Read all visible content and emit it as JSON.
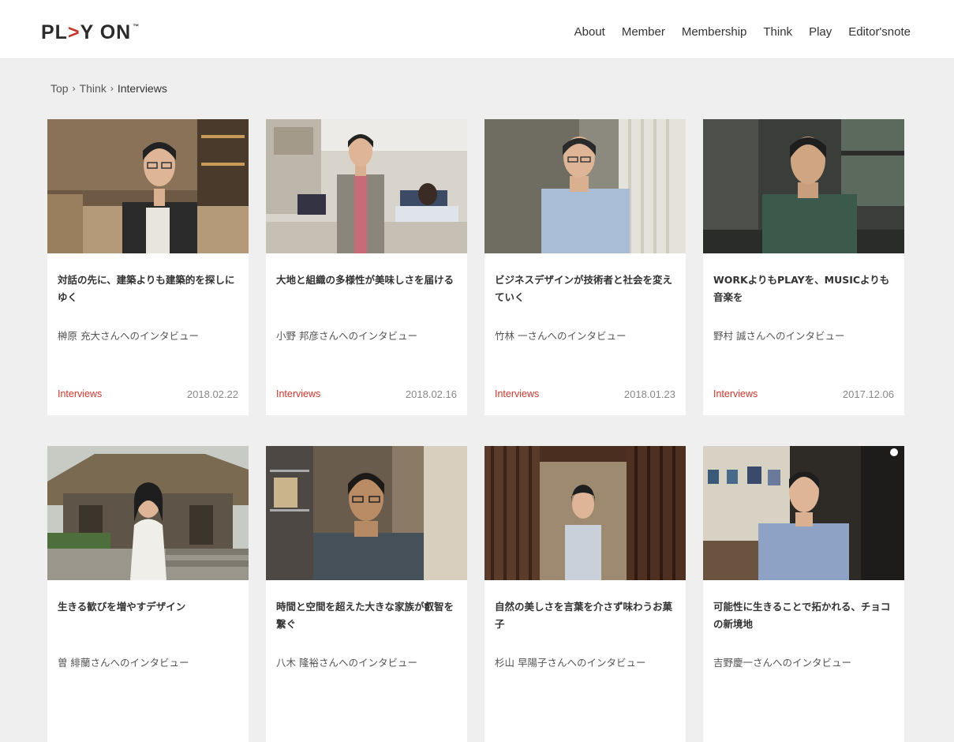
{
  "header": {
    "logo": {
      "part1": "PL",
      "part2": ">",
      "part3": "Y ON",
      "tm": "™"
    },
    "nav": [
      "About",
      "Member",
      "Membership",
      "Think",
      "Play",
      "Editor'snote"
    ]
  },
  "breadcrumb": {
    "items": [
      "Top",
      "Think"
    ],
    "separator": "›",
    "current": "Interviews"
  },
  "colors": {
    "accent": "#c8372d",
    "background": "#efefef"
  },
  "cards": [
    {
      "title": "対話の先に、建築よりも建築的を探しにゆく",
      "author": "榊原 充大さんへのインタビュー",
      "category": "Interviews",
      "date": "2018.02.22"
    },
    {
      "title": "大地と組織の多様性が美味しさを届ける",
      "author": "小野 邦彦さんへのインタビュー",
      "category": "Interviews",
      "date": "2018.02.16"
    },
    {
      "title": "ビジネスデザインが技術者と社会を変えていく",
      "author": "竹林 一さんへのインタビュー",
      "category": "Interviews",
      "date": "2018.01.23"
    },
    {
      "title": "WORKよりもPLAYを、MUSICよりも音楽を",
      "author": "野村 誠さんへのインタビュー",
      "category": "Interviews",
      "date": "2017.12.06"
    },
    {
      "title": "生きる歓びを増やすデザイン",
      "author": "曽 緋蘭さんへのインタビュー",
      "category": "",
      "date": ""
    },
    {
      "title": "時間と空間を超えた大きな家族が叡智を繋ぐ",
      "author": "八木 隆裕さんへのインタビュー",
      "category": "",
      "date": ""
    },
    {
      "title": "自然の美しさを言葉を介さず味わうお菓子",
      "author": "杉山 早陽子さんへのインタビュー",
      "category": "",
      "date": ""
    },
    {
      "title": "可能性に生きることで拓かれる、チョコの新境地",
      "author": "吉野慶一さんへのインタビュー",
      "category": "",
      "date": ""
    }
  ]
}
